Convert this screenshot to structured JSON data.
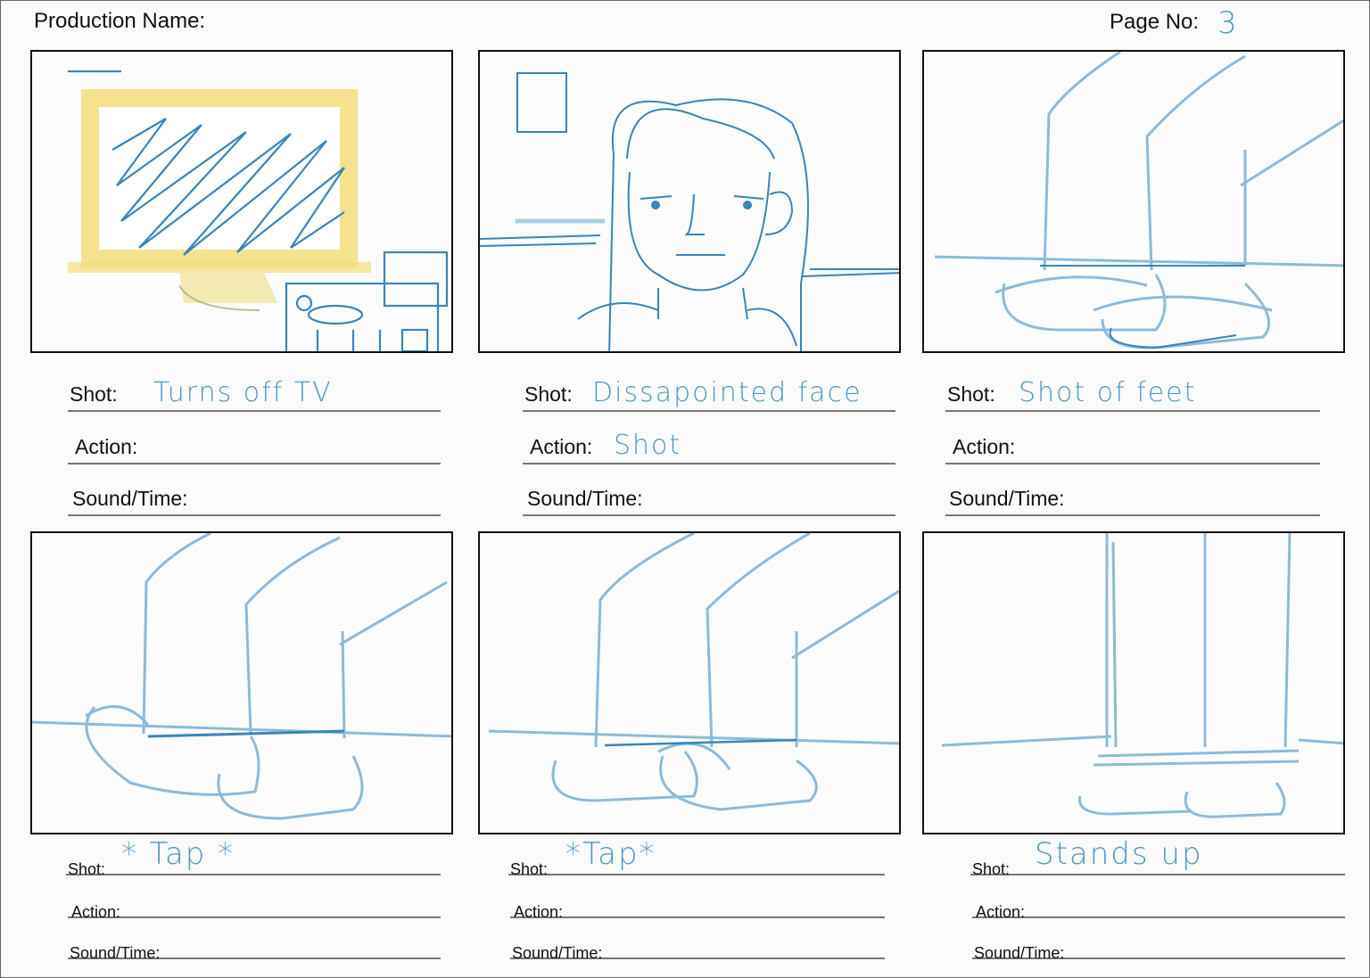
{
  "header": {
    "production_label": "Production Name:",
    "page_label": "Page No:",
    "page_number": "3"
  },
  "frames": [
    {
      "shot_label": "Shot:",
      "shot": "Turns off TV",
      "action_label": "Action:",
      "action": "",
      "sound_label": "Sound/Time:",
      "sound": ""
    },
    {
      "shot_label": "Shot:",
      "shot": "Dissapointed face",
      "action_label": "Action:",
      "action": "Shot",
      "sound_label": "Sound/Time:",
      "sound": ""
    },
    {
      "shot_label": "Shot:",
      "shot": "Shot of feet",
      "action_label": "Action:",
      "action": "",
      "sound_label": "Sound/Time:",
      "sound": ""
    },
    {
      "shot_label": "Shot:",
      "shot": "* Tap *",
      "action_label": "Action:",
      "action": "",
      "sound_label": "Sound/Time:",
      "sound": ""
    },
    {
      "shot_label": "Shot:",
      "shot": "*Tap*",
      "action_label": "Action:",
      "action": "",
      "sound_label": "Sound/Time:",
      "sound": ""
    },
    {
      "shot_label": "Shot:",
      "shot": "Stands up",
      "action_label": "Action:",
      "action": "",
      "sound_label": "Sound/Time:",
      "sound": ""
    }
  ],
  "sketch_colors": {
    "ink": "#3a84b8",
    "light": "#8dbad8",
    "tv_yellow": "#f3dd7a"
  }
}
